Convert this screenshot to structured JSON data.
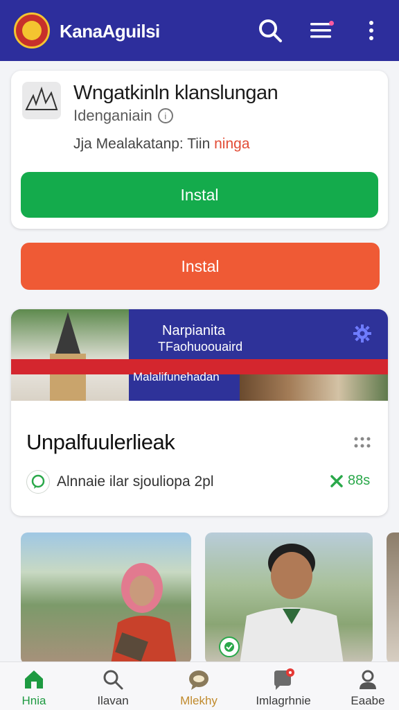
{
  "app_bar": {
    "title": "KanaAguilsi",
    "icons": [
      "logo-emblem",
      "search-icon",
      "menu-icon",
      "more-vertical-icon"
    ]
  },
  "app_card": {
    "name": "Wngatkinln klanslungan",
    "developer": "Idenganiain",
    "meta_prefix": "Jja Mealakatanp: Tiin",
    "meta_highlight": "ninga",
    "install_label": "Instal"
  },
  "secondary_button": {
    "label": "Instal"
  },
  "feature": {
    "banner_title": "Narpianita",
    "banner_subtitle": "TFaohuoouaird",
    "banner_strip": "Malalifunehadan",
    "title": "Unpalfuulerlieak",
    "subtitle": "Alnnaie ilar sjouliopa 2pl",
    "count": "88s"
  },
  "bottom_nav": [
    {
      "label": "Hnia",
      "icon": "home-icon"
    },
    {
      "label": "Ilavan",
      "icon": "search-icon"
    },
    {
      "label": "Mlekhy",
      "icon": "chat-bubble-icon"
    },
    {
      "label": "Imlagrhnie",
      "icon": "notification-icon"
    },
    {
      "label": "Eaabe",
      "icon": "profile-icon"
    }
  ],
  "colors": {
    "app_bar": "#2d2e9c",
    "install_green": "#14ab4c",
    "install_orange": "#ef5a35",
    "accent_red": "#d4262e"
  }
}
